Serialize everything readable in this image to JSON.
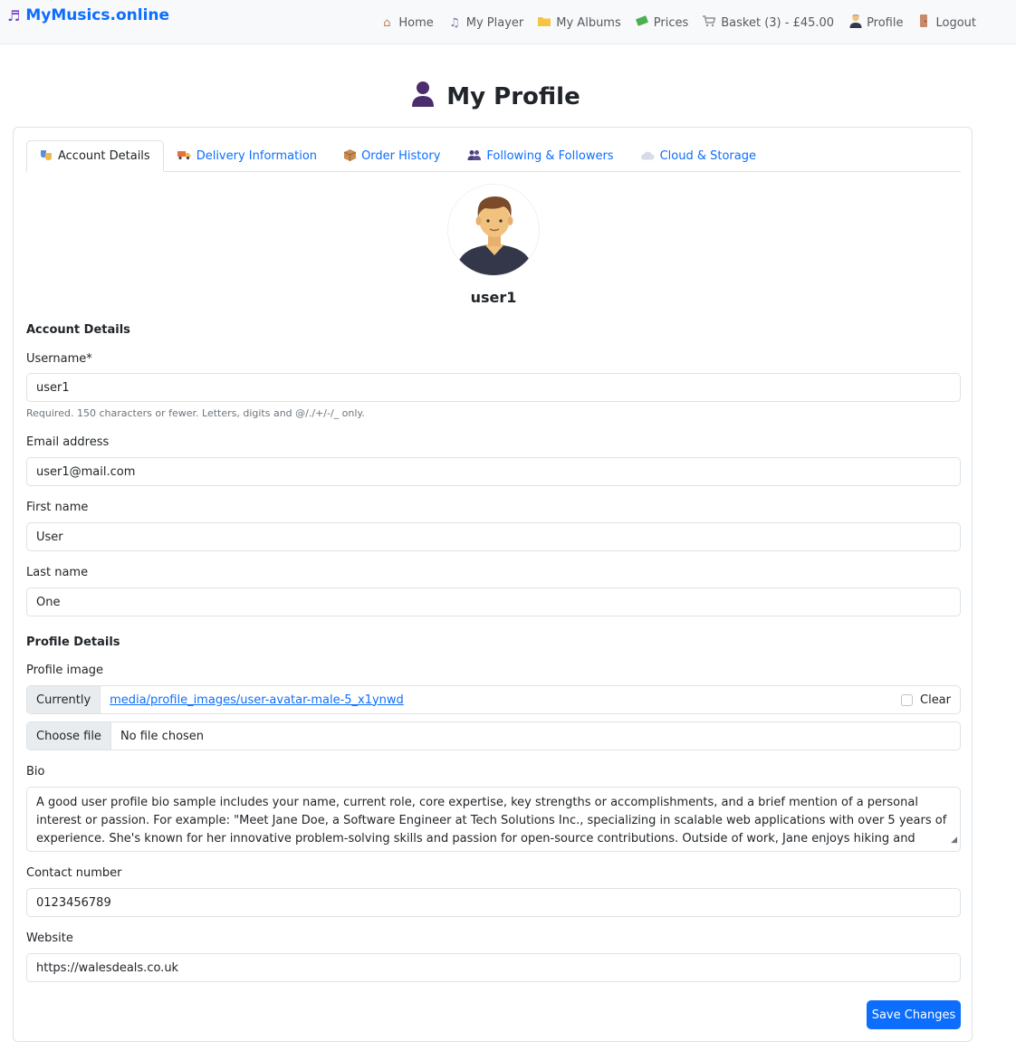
{
  "brand": {
    "name": "MyMusics.online"
  },
  "nav": [
    {
      "icon": "home-icon",
      "label": "Home"
    },
    {
      "icon": "music-note-icon",
      "label": "My Player"
    },
    {
      "icon": "folder-icon",
      "label": "My Albums"
    },
    {
      "icon": "money-icon",
      "label": "Prices"
    },
    {
      "icon": "cart-icon",
      "label": "Basket (3) - £45.00"
    },
    {
      "icon": "user-icon",
      "label": "Profile"
    },
    {
      "icon": "door-icon",
      "label": "Logout"
    }
  ],
  "page": {
    "title": "My Profile"
  },
  "tabs": [
    {
      "label": "Account Details"
    },
    {
      "label": "Delivery Information"
    },
    {
      "label": "Order History"
    },
    {
      "label": "Following & Followers"
    },
    {
      "label": "Cloud & Storage"
    }
  ],
  "profile": {
    "username_display": "user1"
  },
  "form": {
    "account_section": "Account Details",
    "username": {
      "label": "Username*",
      "value": "user1",
      "help": "Required. 150 characters or fewer. Letters, digits and @/./+/-/_ only."
    },
    "email": {
      "label": "Email address",
      "value": "user1@mail.com"
    },
    "first_name": {
      "label": "First name",
      "value": "User"
    },
    "last_name": {
      "label": "Last name",
      "value": "One"
    },
    "profile_section": "Profile Details",
    "profile_image": {
      "label": "Profile image",
      "currently_label": "Currently",
      "current_path": "media/profile_images/user-avatar-male-5_x1ynwd",
      "clear_label": "Clear",
      "choose_label": "Choose file",
      "no_file": "No file chosen"
    },
    "bio": {
      "label": "Bio",
      "value": "A good user profile bio sample includes your name, current role, core expertise, key strengths or accomplishments, and a brief mention of a personal interest or passion. For example: \"Meet Jane Doe, a Software Engineer at Tech Solutions Inc., specializing in scalable web applications with over 5 years of experience. She's known for her innovative problem-solving skills and passion for open-source contributions. Outside of work, Jane enjoys hiking and exploring new technologies\"."
    },
    "contact": {
      "label": "Contact number",
      "value": "0123456789"
    },
    "website": {
      "label": "Website",
      "value": "https://walesdeals.co.uk"
    },
    "save_label": "Save Changes"
  },
  "colors": {
    "accent": "#0d6efd",
    "navbar_bg": "#f8f9fa"
  }
}
